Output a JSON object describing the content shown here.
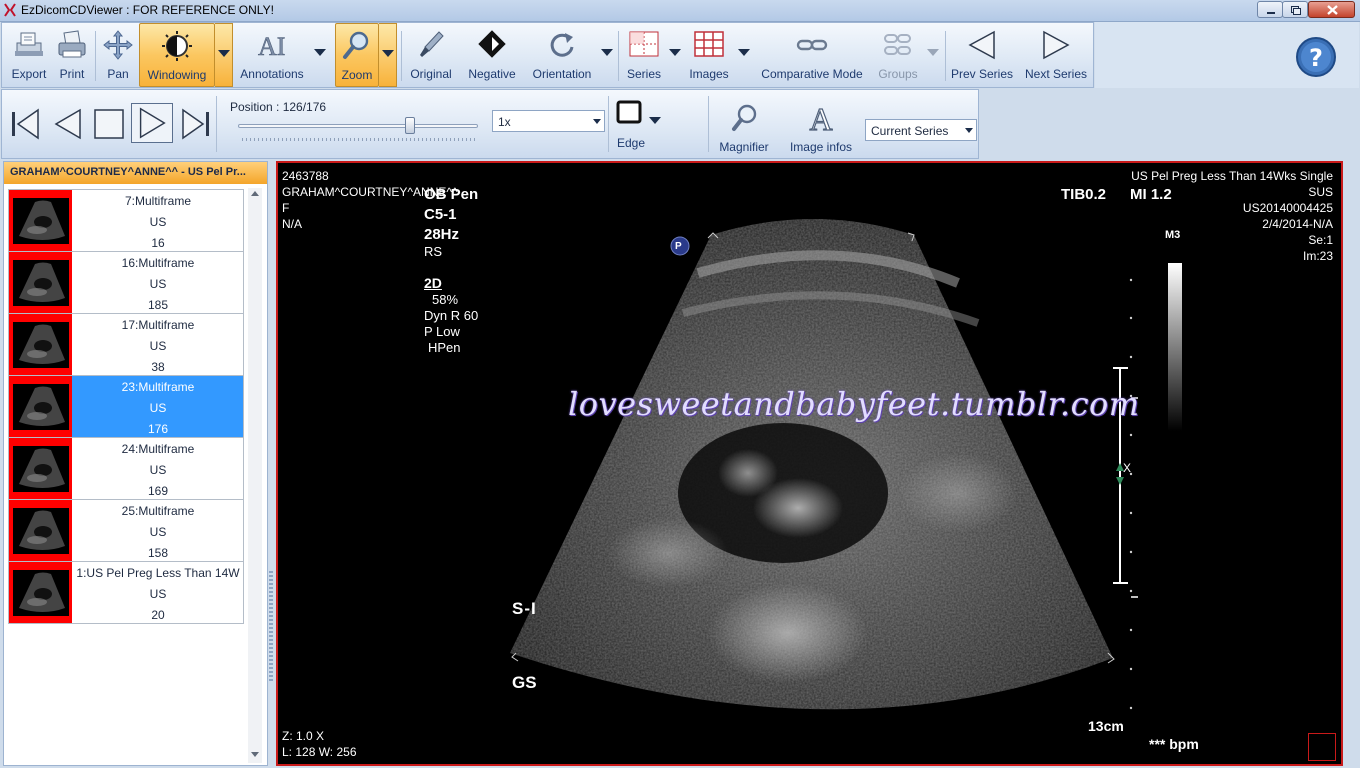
{
  "window": {
    "title": "EzDicomCDViewer : FOR REFERENCE ONLY!"
  },
  "toolbar_main": {
    "items": [
      {
        "label": "Export",
        "icon": "export-icon"
      },
      {
        "label": "Print",
        "icon": "printer-icon"
      },
      {
        "label": "Pan",
        "icon": "pan-arrows-icon"
      },
      {
        "label": "Windowing",
        "icon": "windowing-icon",
        "active": true
      },
      {
        "label": "Annotations",
        "icon": "annotations-icon"
      },
      {
        "label": "Zoom",
        "icon": "magnifier-icon",
        "active": true
      },
      {
        "label": "Original",
        "icon": "original-brush-icon"
      },
      {
        "label": "Negative",
        "icon": "negative-diamond-icon"
      },
      {
        "label": "Orientation",
        "icon": "rotate-icon"
      },
      {
        "label": "Series",
        "icon": "series-grid-icon"
      },
      {
        "label": "Images",
        "icon": "images-grid-icon"
      },
      {
        "label": "Comparative Mode",
        "icon": "link-chain-icon"
      },
      {
        "label": "Groups",
        "icon": "groups-icon",
        "disabled": true
      },
      {
        "label": "Prev Series",
        "icon": "prev-triangle-icon"
      },
      {
        "label": "Next Series",
        "icon": "next-triangle-icon"
      }
    ],
    "help_icon": "help-question-icon"
  },
  "toolbar_playback": {
    "position_label": "Position : 126/176",
    "position_value": 126,
    "position_max": 176,
    "speed": "1x",
    "edge_label": "Edge",
    "magnifier_label": "Magnifier",
    "image_infos_label": "Image infos",
    "series_mode": "Current Series"
  },
  "left_panel": {
    "header": "GRAHAM^COURTNEY^ANNE^^ - US Pel Pr...",
    "series": [
      {
        "title": "7:Multiframe",
        "modality": "US",
        "count": "16",
        "selected": false
      },
      {
        "title": "16:Multiframe",
        "modality": "US",
        "count": "185",
        "selected": false
      },
      {
        "title": "17:Multiframe",
        "modality": "US",
        "count": "38",
        "selected": false
      },
      {
        "title": "23:Multiframe",
        "modality": "US",
        "count": "176",
        "selected": true
      },
      {
        "title": "24:Multiframe",
        "modality": "US",
        "count": "169",
        "selected": false
      },
      {
        "title": "25:Multiframe",
        "modality": "US",
        "count": "158",
        "selected": false
      },
      {
        "title": "1:US Pel Preg Less Than 14W",
        "modality": "US",
        "count": "20",
        "selected": false
      }
    ]
  },
  "viewer": {
    "top_left": {
      "id": "2463788",
      "patient": "GRAHAM^COURTNEY^ANNE^^",
      "sex": "F",
      "age": "N/A"
    },
    "top_right": {
      "study": "US Pel Preg Less Than 14Wks Single",
      "institution": "SUS",
      "accession": "US20140004425",
      "date": "2/4/2014-N/A",
      "series": "Se:1",
      "image": "Im:23"
    },
    "bottom_left": {
      "zoom": "Z: 1.0 X",
      "window": "L: 128 W: 256"
    },
    "burned_in": {
      "preset": "OB Pen",
      "probe": "C5-1",
      "rate": "28Hz",
      "rs": "RS",
      "mode": "2D",
      "gain": "58%",
      "dyn": "Dyn R 60",
      "power": "P Low",
      "hpen": "HPen",
      "tib": "TIB0.2",
      "mi": "MI 1.2",
      "map": "M3",
      "orientation": "S-I",
      "gs": "GS",
      "depth": "13cm",
      "bpm": "*** bpm",
      "p_marker": "P",
      "x_marker": "X"
    },
    "watermark": "lovesweetandbabyfeet.tumblr.com"
  }
}
